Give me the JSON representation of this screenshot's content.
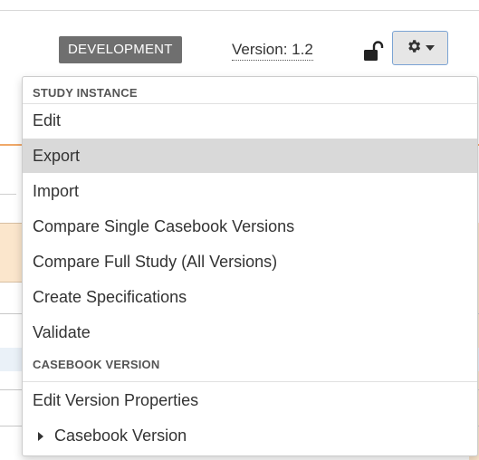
{
  "toolbar": {
    "environment_badge": "DEVELOPMENT",
    "version_label": "Version: 1.2",
    "lock_icon": "unlocked-padlock",
    "settings_icon": "gear-icon",
    "dropdown_icon": "caret-down-icon"
  },
  "menu": {
    "sections": [
      {
        "header": "STUDY INSTANCE",
        "items": [
          "Edit",
          "Export",
          "Import",
          "Compare Single Casebook Versions",
          "Compare Full Study (All Versions)",
          "Create Specifications",
          "Validate"
        ]
      },
      {
        "header": "CASEBOOK VERSION",
        "items": [
          "Edit Version Properties",
          "Casebook Version"
        ]
      }
    ],
    "highlighted_item": "Export"
  },
  "colors": {
    "badge_bg": "#6f6f6f",
    "highlight_bg": "#d9d9d9",
    "button_border": "#7aa3d4",
    "accent_line": "#f0a868"
  }
}
